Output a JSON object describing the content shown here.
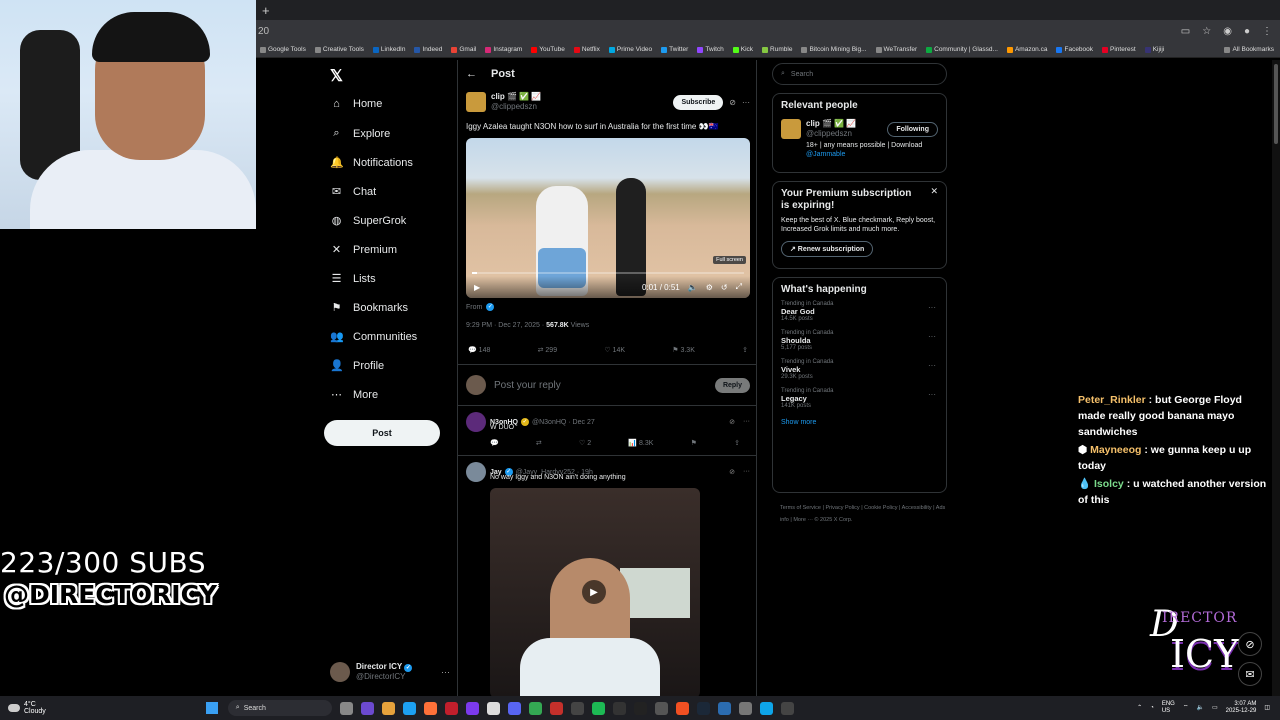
{
  "browser": {
    "address_fragment": "20",
    "bookmarks": [
      "Google Tools",
      "Creative Tools",
      "LinkedIn",
      "Indeed",
      "Gmail",
      "Instagram",
      "YouTube",
      "Netflix",
      "Prime Video",
      "Twitter",
      "Twitch",
      "Kick",
      "Rumble",
      "Bitcoin Mining Big...",
      "WeTransfer",
      "Community | Glassd...",
      "Amazon.ca",
      "Facebook",
      "Pinterest",
      "Kijiji"
    ],
    "all_bookmarks": "All Bookmarks"
  },
  "overlay": {
    "subs_count": "223/300 SUBS",
    "handle": "@DIRECTORICY",
    "chat": [
      {
        "user": "Peter_Rinkler",
        "user_color": "#f5c06a",
        "text": " : but George Floyd made really good banana mayo sandwiches"
      },
      {
        "user": "Mayneeog",
        "user_color": "#f5c06a",
        "text": " : we gunna keep u up today"
      },
      {
        "user": "Isolcy",
        "user_color": "#7cdc8c",
        "text": " : u watched another version of this"
      }
    ],
    "logo_line1": "D",
    "logo_line2": "IRECTOR",
    "logo_line3": "ICY"
  },
  "nav": {
    "items": [
      {
        "label": "Home",
        "icon": "home-icon",
        "glyph": "⌂"
      },
      {
        "label": "Explore",
        "icon": "search-icon",
        "glyph": "⌕"
      },
      {
        "label": "Notifications",
        "icon": "bell-icon",
        "glyph": "🔔"
      },
      {
        "label": "Chat",
        "icon": "mail-icon",
        "glyph": "✉"
      },
      {
        "label": "SuperGrok",
        "icon": "grok-icon",
        "glyph": "◍"
      },
      {
        "label": "Premium",
        "icon": "x-icon",
        "glyph": "✕"
      },
      {
        "label": "Lists",
        "icon": "list-icon",
        "glyph": "☰"
      },
      {
        "label": "Bookmarks",
        "icon": "bookmark-icon",
        "glyph": "⚑"
      },
      {
        "label": "Communities",
        "icon": "people-icon",
        "glyph": "👥"
      },
      {
        "label": "Profile",
        "icon": "person-icon",
        "glyph": "👤"
      },
      {
        "label": "More",
        "icon": "more-icon",
        "glyph": "⋯"
      }
    ],
    "post_label": "Post",
    "profile_name": "Director ICY",
    "profile_handle": "@DirectorICY"
  },
  "post": {
    "header": "Post",
    "author_name": "clip 🎬 ✅ 📈",
    "author_handle": "@clippedszn",
    "subscribe": "Subscribe",
    "text": "Iggy Azalea taught N3ON how to surf in Australia for the first time 👀🇦🇺",
    "video_time": "0:01 / 0:51",
    "video_progress": 0.02,
    "fullscreen_tip": "Full screen",
    "from": "From",
    "timestamp": "9:29 PM · Dec 27, 2025 · ",
    "views_count": "567.8K",
    "views_label": " Views",
    "replies": "148",
    "reposts": "299",
    "likes": "14K",
    "bookmarks": "3.3K",
    "reply_placeholder": "Post your reply",
    "reply_button": "Reply"
  },
  "replies": [
    {
      "name": "N3onHQ",
      "handle": "@N3onHQ · Dec 27",
      "text": "W DUO",
      "replies": "",
      "reposts": "",
      "likes": "2",
      "views": "8.3K"
    },
    {
      "name": "Jay",
      "handle": "@Jayy_Hardyy252 · 19h",
      "text": "No way Iggy and N3ON ain't doing anything"
    }
  ],
  "sidebar": {
    "search_placeholder": "Search",
    "relevant_title": "Relevant people",
    "rp_name": "clip 🎬 ✅ 📈",
    "rp_handle": "@clippedszn",
    "rp_follow": "Following",
    "rp_bio": "18+ | any means possible | Download ",
    "rp_bio_link": "@Jammable",
    "premium_title": "Your Premium subscription is expiring!",
    "premium_text": "Keep the best of X. Blue checkmark, Reply boost, Increased Grok limits and much more.",
    "renew": "↗ Renew subscription",
    "happening_title": "What's happening",
    "trends": [
      {
        "loc": "Trending in Canada",
        "topic": "Dear God",
        "count": "14.5K posts"
      },
      {
        "loc": "Trending in Canada",
        "topic": "Shoulda",
        "count": "5,177 posts"
      },
      {
        "loc": "Trending in Canada",
        "topic": "Vivek",
        "count": "29.3K posts"
      },
      {
        "loc": "Trending in Canada",
        "topic": "Legacy",
        "count": "141K posts"
      }
    ],
    "show_more": "Show more",
    "footer": "Terms of Service  |  Privacy Policy  |  Cookie Policy  |  Accessibility  |  Ads info  |  More ···  © 2025 X Corp."
  },
  "taskbar": {
    "temp": "4°C",
    "weather": "Cloudy",
    "search": "Search",
    "lang1": "ENG",
    "lang2": "US",
    "time": "3:07 AM",
    "date": "2025-12-29"
  }
}
